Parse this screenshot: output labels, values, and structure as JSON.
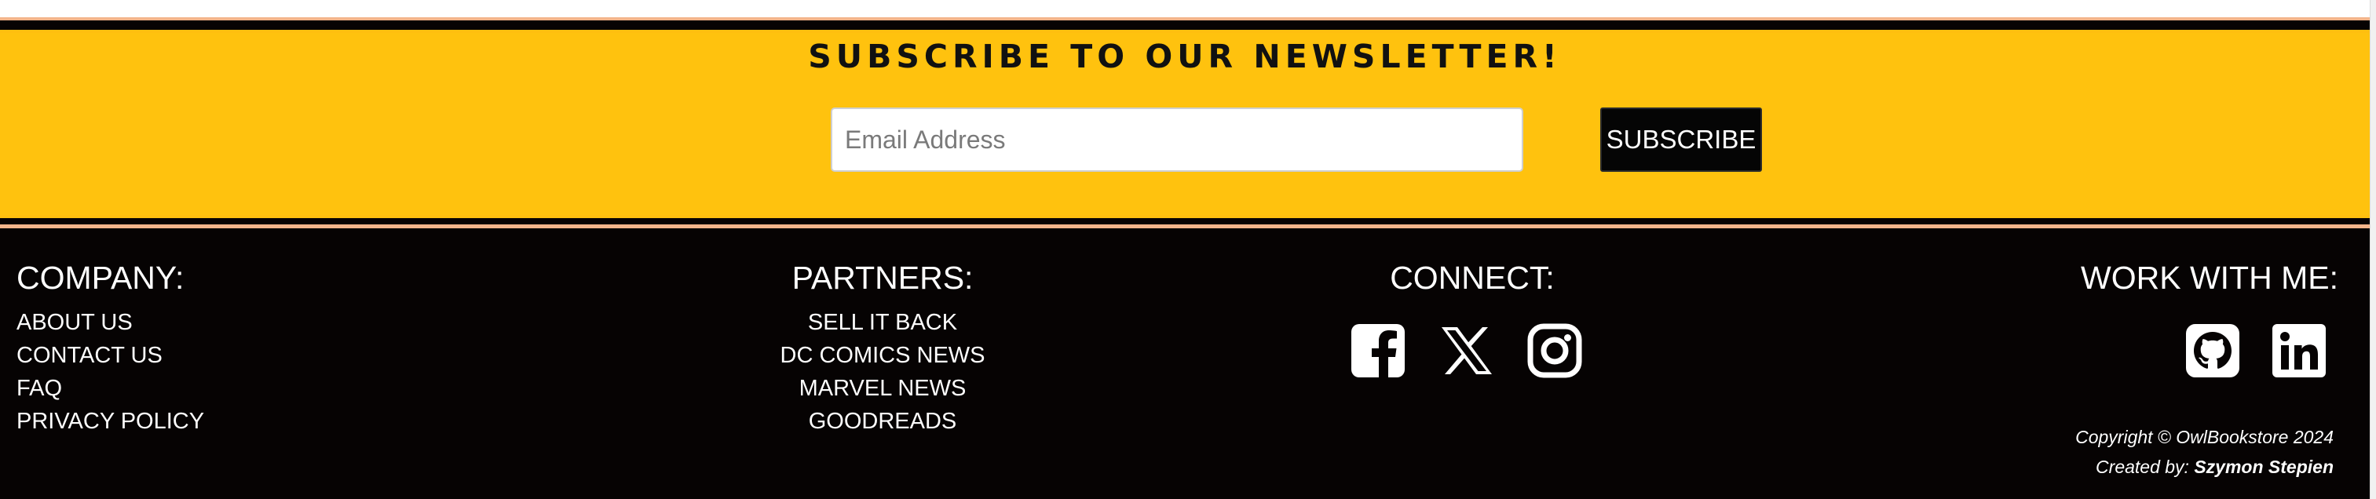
{
  "newsletter": {
    "title": "SUBSCRIBE TO OUR NEWSLETTER!",
    "email_placeholder": "Email Address",
    "subscribe_label": "SUBSCRIBE"
  },
  "footer": {
    "company": {
      "heading": "COMPANY:",
      "links": [
        "ABOUT US",
        "CONTACT US",
        "FAQ",
        "PRIVACY POLICY"
      ]
    },
    "partners": {
      "heading": "PARTNERS:",
      "links": [
        "SELL IT BACK",
        "DC COMICS NEWS",
        "MARVEL NEWS",
        "GOODREADS"
      ]
    },
    "connect": {
      "heading": "CONNECT:",
      "icons": [
        "facebook-icon",
        "x-twitter-icon",
        "instagram-icon"
      ]
    },
    "work": {
      "heading": "WORK WITH ME:",
      "icons": [
        "github-icon",
        "linkedin-icon"
      ]
    },
    "copyright": "Copyright © OwlBookstore 2024",
    "created_by_label": "Created by:",
    "created_by_name": "Szymon Stepien"
  },
  "colors": {
    "accent_yellow": "#ffc20e",
    "footer_black": "#060303",
    "stripe_peach": "#f3b58b"
  }
}
